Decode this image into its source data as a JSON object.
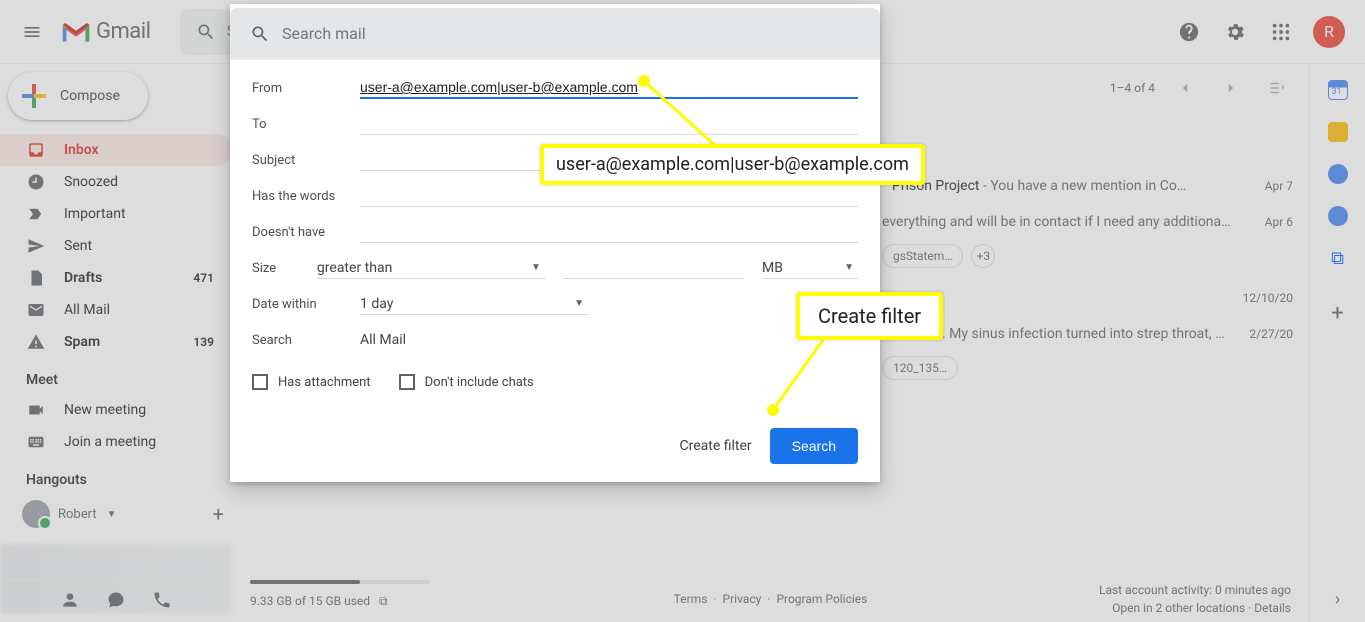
{
  "header": {
    "brand": "Gmail",
    "search_placeholder": "Search mail",
    "avatar_letter": "R"
  },
  "compose_label": "Compose",
  "nav": {
    "inbox": "Inbox",
    "snoozed": "Snoozed",
    "important": "Important",
    "sent": "Sent",
    "drafts": "Drafts",
    "drafts_count": "471",
    "allmail": "All Mail",
    "spam": "Spam",
    "spam_count": "139"
  },
  "meet": {
    "label": "Meet",
    "new_meeting": "New meeting",
    "join_meeting": "Join a meeting"
  },
  "hangouts": {
    "label": "Hangouts",
    "user": "Robert"
  },
  "toolbar": {
    "range": "1–4 of 4"
  },
  "rows": {
    "r1_subject": "Prison Project",
    "r1_body": " - You have a new mention in Co…",
    "r1_date": "Apr 7",
    "r2_body": "everything and will be in contact if I need any additiona…",
    "r2_date": "Apr 6",
    "chip1": "gsStatem…",
    "chip2": "+3",
    "r3_date": "12/10/20",
    "r4_body": ". My sinus infection turned into strep throat, …",
    "r4_date": "2/27/20",
    "chip3": "120_135…"
  },
  "footer": {
    "storage": "9.33 GB of 15 GB used",
    "terms": "Terms",
    "privacy": "Privacy",
    "policies": "Program Policies",
    "activity": "Last account activity: 0 minutes ago",
    "locations": "Open in 2 other locations",
    "details": "Details"
  },
  "filter": {
    "from_label": "From",
    "from_value": "user-a@example.com|user-b@example.com",
    "to_label": "To",
    "subject_label": "Subject",
    "haswords_label": "Has the words",
    "doesnthave_label": "Doesn't have",
    "size_label": "Size",
    "size_op": "greater than",
    "size_unit": "MB",
    "date_label": "Date within",
    "date_value": "1 day",
    "search_label": "Search",
    "search_value": "All Mail",
    "has_attachment": "Has attachment",
    "no_chats": "Don't include chats",
    "create_filter": "Create filter",
    "search_btn": "Search"
  },
  "callouts": {
    "from_text": "user-a@example.com|user-b@example.com",
    "create_filter_text": "Create filter"
  }
}
